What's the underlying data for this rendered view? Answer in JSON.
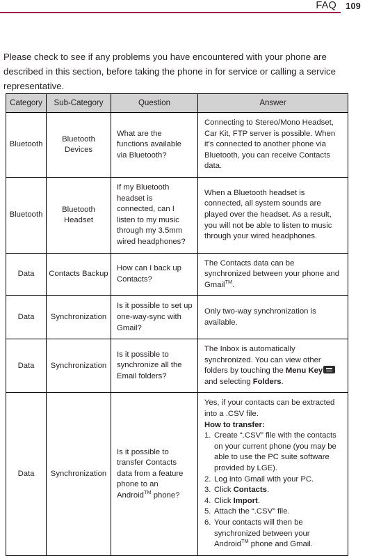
{
  "header": {
    "section_title": "FAQ",
    "page_number": "109",
    "rule_color": "#a8104a"
  },
  "intro": {
    "text": "Please check to see if any problems you have encountered with your phone are described in this section, before taking the phone in for service or calling a service representative."
  },
  "table": {
    "header_background": "#d2d2d2",
    "columns": [
      "Category",
      "Sub-Category",
      "Question",
      "Answer"
    ],
    "rows": [
      {
        "category": "Bluetooth",
        "subcategory": "Bluetooth Devices",
        "question": "What are the functions available via Bluetooth?",
        "answer": "Connecting to Stereo/Mono Headset, Car Kit, FTP server is possible. When it's connected to another phone via Bluetooth, you can receive Contacts data."
      },
      {
        "category": "Bluetooth",
        "subcategory": "Bluetooth Headset",
        "question": "If my Bluetooth headset is connected, can I listen to my music through my 3.5mm wired headphones?",
        "answer": "When a Bluetooth headset is connected, all system sounds are played over the headset. As a result, you will not be able to listen to music through your wired headphones."
      },
      {
        "category": "Data",
        "subcategory": "Contacts Backup",
        "question": "How can I back up Contacts?",
        "answer_part1": "The Contacts data can be synchronized between your phone and Gmail",
        "answer_tm": "TM",
        "answer_part2": "."
      },
      {
        "category": "Data",
        "subcategory": "Synchronization",
        "question": "Is it possible to set up one-way-sync with Gmail?",
        "answer": "Only two-way synchronization is available."
      },
      {
        "category": "Data",
        "subcategory": "Synchronization",
        "question": "Is it possible to synchronize all the Email folders?",
        "answer_part1": "The Inbox is automatically synchronized. You can view other folders by touching the ",
        "answer_bold1": "Menu Key",
        "answer_icon": "menu-key-icon",
        "answer_part2": " and selecting ",
        "answer_bold2": "Folders",
        "answer_part3": "."
      },
      {
        "category": "Data",
        "subcategory": "Synchronization",
        "question_part1": "Is it possible to transfer Contacts data from a feature phone to an Android",
        "question_tm": "TM",
        "question_part2": " phone?",
        "answer_intro": "Yes, if your contacts can be extracted into a .CSV file.",
        "answer_heading": "How to transfer:",
        "steps": [
          {
            "num": "1.",
            "text": "Create “.CSV” file with the contacts on your current phone (you may be able to use the PC suite software provided by LGE)."
          },
          {
            "num": "2.",
            "text": "Log into Gmail with your PC."
          },
          {
            "num": "3.",
            "text_prefix": "Click ",
            "text_bold": "Contacts",
            "text_suffix": "."
          },
          {
            "num": "4.",
            "text_prefix": "Click ",
            "text_bold": "Import",
            "text_suffix": "."
          },
          {
            "num": "5.",
            "text": "Attach the “.CSV” file."
          },
          {
            "num": "6.",
            "text_prefix": "Your contacts will then be synchronized between your Android",
            "text_tm": "TM",
            "text_suffix": " phone and Gmail."
          }
        ]
      }
    ]
  }
}
